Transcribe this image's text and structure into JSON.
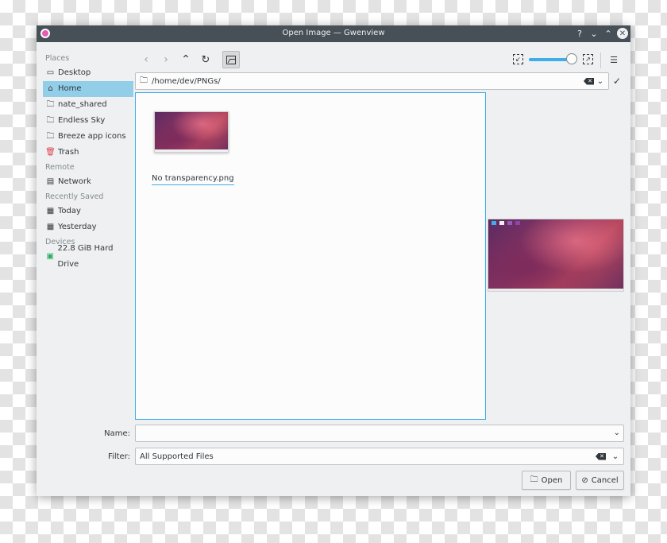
{
  "window": {
    "title": "Open Image — Gwenview"
  },
  "titlebar": {
    "help_glyph": "?",
    "minimize_glyph": "⌄",
    "maximize_glyph": "⌃",
    "close_glyph": "✕"
  },
  "sidebar": {
    "sections": [
      {
        "label": "Places",
        "items": [
          {
            "label": "Desktop",
            "icon": "desktop-icon"
          },
          {
            "label": "Home",
            "icon": "home-icon",
            "active": true
          },
          {
            "label": "nate_shared",
            "icon": "folder-icon"
          },
          {
            "label": "Endless Sky",
            "icon": "folder-icon"
          },
          {
            "label": "Breeze app icons",
            "icon": "folder-icon"
          },
          {
            "label": "Trash",
            "icon": "trash-icon"
          }
        ]
      },
      {
        "label": "Remote",
        "items": [
          {
            "label": "Network",
            "icon": "network-icon"
          }
        ]
      },
      {
        "label": "Recently Saved",
        "items": [
          {
            "label": "Today",
            "icon": "calendar-icon"
          },
          {
            "label": "Yesterday",
            "icon": "calendar-icon"
          }
        ]
      },
      {
        "label": "Devices",
        "items": [
          {
            "label": "22.8 GiB Hard Drive",
            "icon": "hard-drive-icon"
          }
        ]
      }
    ]
  },
  "toolbar": {
    "back_icon": "back-arrow-icon",
    "forward_icon": "forward-arrow-icon",
    "up_icon": "parent-folder-icon",
    "reload_icon": "reload-icon",
    "preview_toggle_icon": "image-preview-icon",
    "zoom_level_fraction": 0.9
  },
  "location": {
    "path": "/home/dev/PNGs/"
  },
  "files": [
    {
      "name": "No transparency.png",
      "icon": "image-thumbnail"
    }
  ],
  "form": {
    "name_label": "Name:",
    "name_value": "",
    "filter_label": "Filter:",
    "filter_value": "All Supported Files"
  },
  "buttons": {
    "open_label": "Open",
    "cancel_label": "Cancel"
  },
  "colors": {
    "accent": "#3daee9",
    "selection": "#93cee9",
    "titlebar": "#475057",
    "window_bg": "#eff0f1"
  }
}
